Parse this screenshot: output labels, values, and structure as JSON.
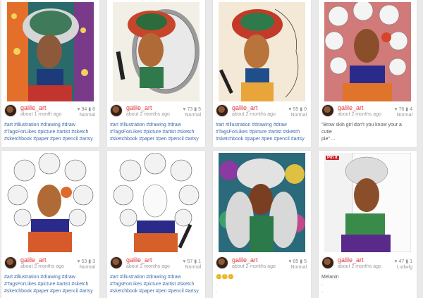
{
  "posts": [
    {
      "user": "galile_art",
      "time": "about 1 month ago",
      "likes": "94",
      "comments": "8",
      "filter": "Normal",
      "caption_lines": [
        "#art #illustration #drawing #draw",
        "#TagsForLikes #picture #artist #sketch",
        "#sketchbook #paper #pen #pencil #artsy"
      ]
    },
    {
      "user": "galile_art",
      "time": "about 2 months ago",
      "likes": "73",
      "comments": "5",
      "filter": "Normal",
      "caption_lines": [
        "#art #illustration #drawing #draw",
        "#TagsForLikes #picture #artist #sketch",
        "#sketchbook #paper #pen #pencil #artsy"
      ]
    },
    {
      "user": "galile_art",
      "time": "about 2 months ago",
      "likes": "55",
      "comments": "0",
      "filter": "Normal",
      "caption_lines": [
        "#art #illustration #drawing #draw",
        "#TagsForLikes #picture #artist #sketch",
        "#sketchbook #paper #pen #pencil #artsy"
      ]
    },
    {
      "user": "galile_art",
      "time": "about 2 months ago",
      "likes": "76",
      "comments": "4",
      "filter": "Normal",
      "caption_lines": [
        "\"Brow skin girl don't you know your a cutie",
        "pie\" ..."
      ]
    },
    {
      "user": "galile_art",
      "time": "about 2 months ago",
      "likes": "53",
      "comments": "3",
      "filter": "Normal",
      "caption_lines": [
        "#art #illustration #drawing #draw",
        "#TagsForLikes #picture #artist #sketch",
        "#sketchbook #paper #pen #pencil #artsy"
      ]
    },
    {
      "user": "galile_art",
      "time": "about 2 months ago",
      "likes": "57",
      "comments": "1",
      "filter": "Normal",
      "caption_lines": [
        "#art #illustration #drawing #draw",
        "#TagsForLikes #picture #artist #sketch",
        "#sketchbook #paper #pen #pencil #artsy"
      ]
    },
    {
      "user": "galile_art",
      "time": "about 2 months ago",
      "likes": "85",
      "comments": "5",
      "filter": "Normal",
      "caption_lines": [
        "😊😊😊",
        ".",
        "."
      ]
    },
    {
      "user": "galile_art",
      "time": "about 2 months ago",
      "likes": "47",
      "comments": "1",
      "filter": "Ludwig",
      "caption_lines": [
        "Melanin",
        ".",
        "."
      ]
    }
  ],
  "pinit_label": "Pin it",
  "icons": {
    "likes": "heart-icon",
    "comments": "speech-bubble-icon"
  },
  "colors": {
    "username": "#e0373b",
    "hashtag": "#3a6aa8",
    "background": "#e9e9e9"
  }
}
